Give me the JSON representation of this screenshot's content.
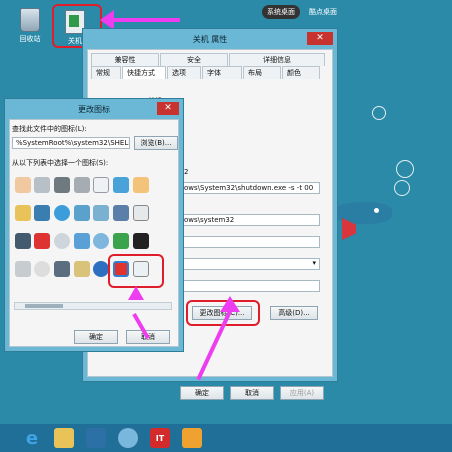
{
  "topbar": {
    "tab1": "系统桌面",
    "tab2": "酷点桌面"
  },
  "desktop": {
    "recycle_label": "回收站",
    "shutdown_label": "关机"
  },
  "props_window": {
    "title": "关机 属性",
    "tabs_row1": [
      "兼容性",
      "安全",
      "详细信息"
    ],
    "tabs_row2": [
      "常规",
      "快捷方式",
      "选项",
      "字体",
      "布局",
      "颜色"
    ],
    "name": "关机",
    "target_value": "ows\\System32\\shutdown.exe -s -t 00",
    "target_suffix": "2",
    "start_in_value": "ows\\system32",
    "change_icon_label": "更改图标(C)...",
    "advanced_label": "高级(D)...",
    "ok_label": "确定",
    "cancel_label": "取消",
    "apply_label": "应用(A)"
  },
  "icon_dialog": {
    "title": "更改图标",
    "find_label": "查找此文件中的图标(L):",
    "path_value": "%SystemRoot%\\system32\\SHELL32.",
    "browse_label": "浏览(B)...",
    "select_label": "从以下列表中选择一个图标(S):",
    "ok_label": "确定",
    "cancel_label": "取消"
  }
}
